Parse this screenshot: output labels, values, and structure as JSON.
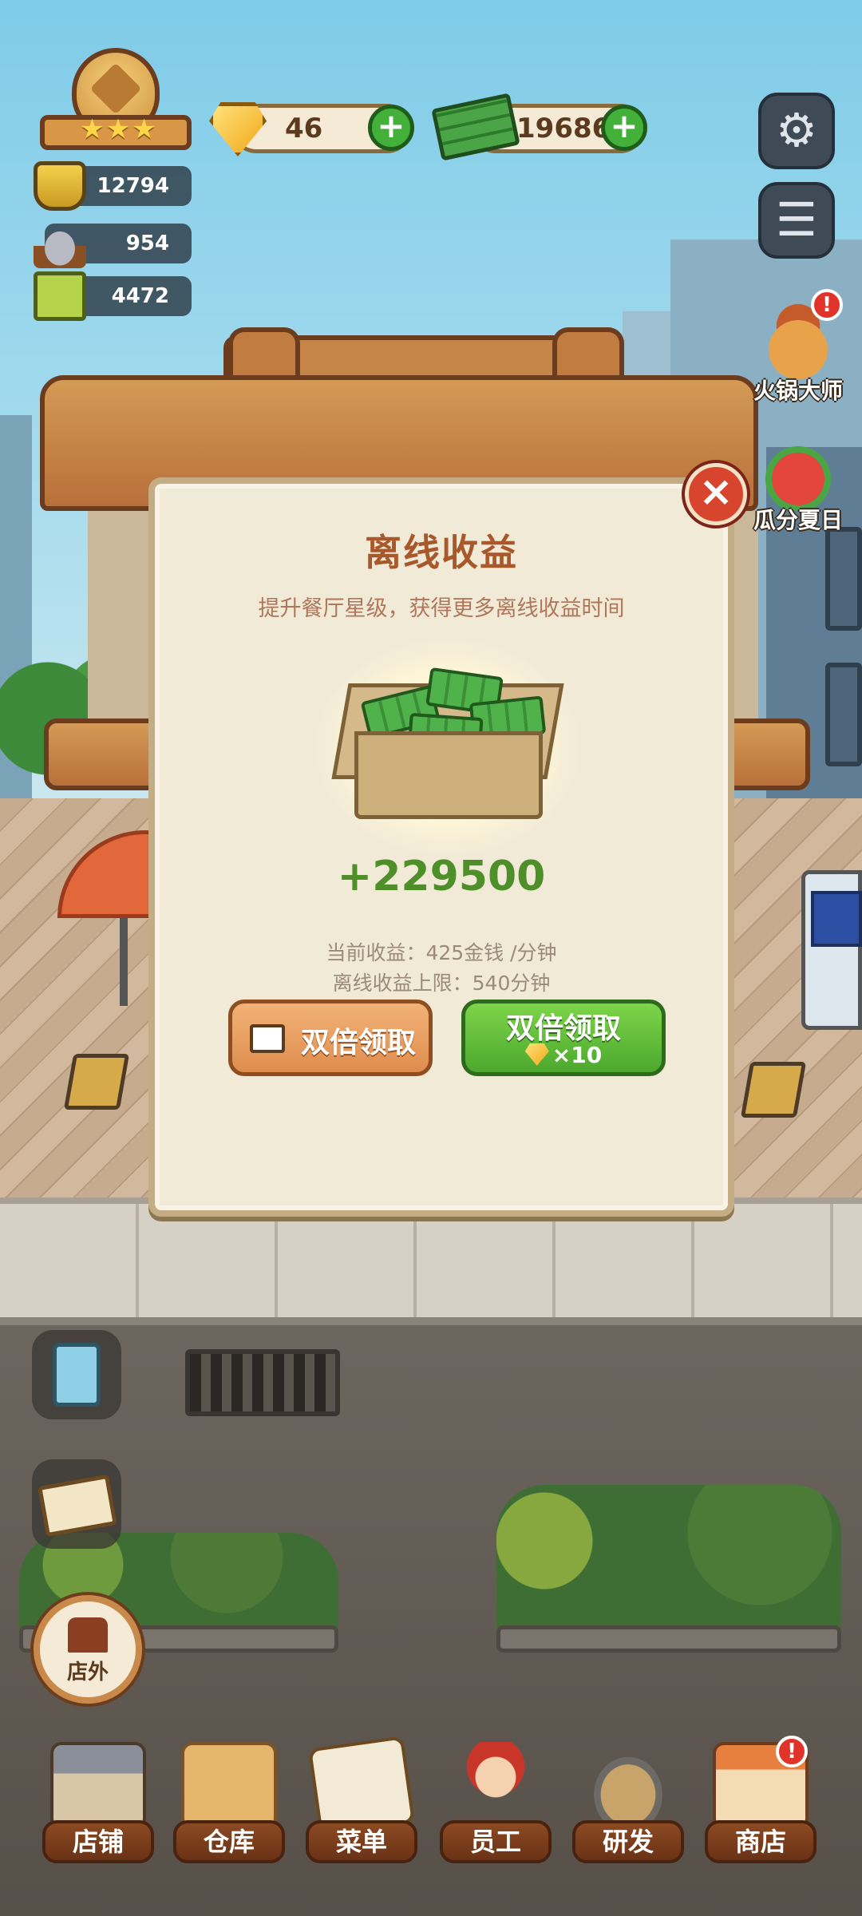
{
  "hud": {
    "stats": [
      {
        "icon": "pot-icon",
        "value": "12794"
      },
      {
        "icon": "dish-cloche-icon",
        "value": "954"
      },
      {
        "icon": "recipe-book-icon",
        "value": "4472"
      }
    ],
    "gems": "46",
    "cash": "19686",
    "plus": "+",
    "star_glyphs": "★★★"
  },
  "side_events": [
    {
      "label": "火锅大师",
      "alert": "!"
    },
    {
      "label": "瓜分夏日"
    }
  ],
  "popup": {
    "title": "离线收益",
    "subtitle": "提升餐厅星级，获得更多离线收益时间",
    "reward": "+229500",
    "current_income": "当前收益：425金钱 /分钟",
    "cap": "离线收益上限：540分钟",
    "btn_video_label": "双倍领取",
    "btn_gem_label": "双倍领取",
    "btn_gem_cost": "×10",
    "close": "×"
  },
  "outside_button": "店外",
  "bottom_nav": [
    {
      "label": "店铺"
    },
    {
      "label": "仓库"
    },
    {
      "label": "菜单"
    },
    {
      "label": "员工"
    },
    {
      "label": "研发"
    },
    {
      "label": "商店",
      "alert": "!"
    }
  ],
  "icons": {
    "settings": "⚙",
    "list": "☰"
  },
  "colors": {
    "reward_green": "#4f8f2a",
    "title_brown": "#a8582a",
    "plus_green": "#43b03a",
    "close_red": "#d8452f"
  }
}
